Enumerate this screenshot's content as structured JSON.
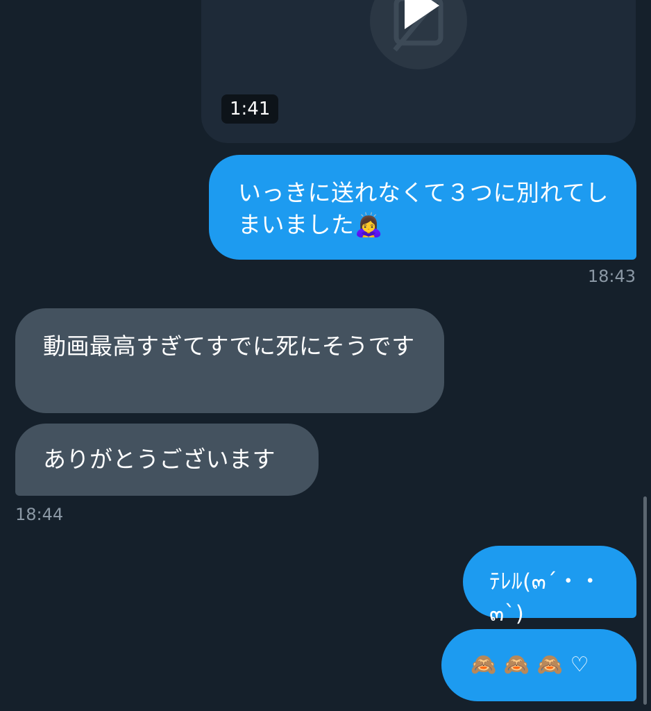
{
  "video": {
    "duration": "1:41",
    "icon": "play-icon"
  },
  "messages": [
    {
      "direction": "outgoing",
      "text": "いっきに送れなくて３つに別れてしまいました🙇‍♀️"
    },
    {
      "direction": "outgoing",
      "time": "18:43"
    },
    {
      "direction": "incoming",
      "text": "動画最高すぎてすでに死にそうです"
    },
    {
      "direction": "incoming",
      "text": "ありがとうございます"
    },
    {
      "direction": "incoming",
      "time": "18:44"
    },
    {
      "direction": "outgoing",
      "text": "ﾃﾚﾙ(๓´・・๓`)"
    },
    {
      "direction": "outgoing",
      "text": "🙈 🙈 🙈 ♡"
    }
  ],
  "colors": {
    "background": "#15202b",
    "outgoing_bubble": "#1d9bf0",
    "incoming_bubble": "#44525f",
    "timestamp": "#8b98a5"
  }
}
